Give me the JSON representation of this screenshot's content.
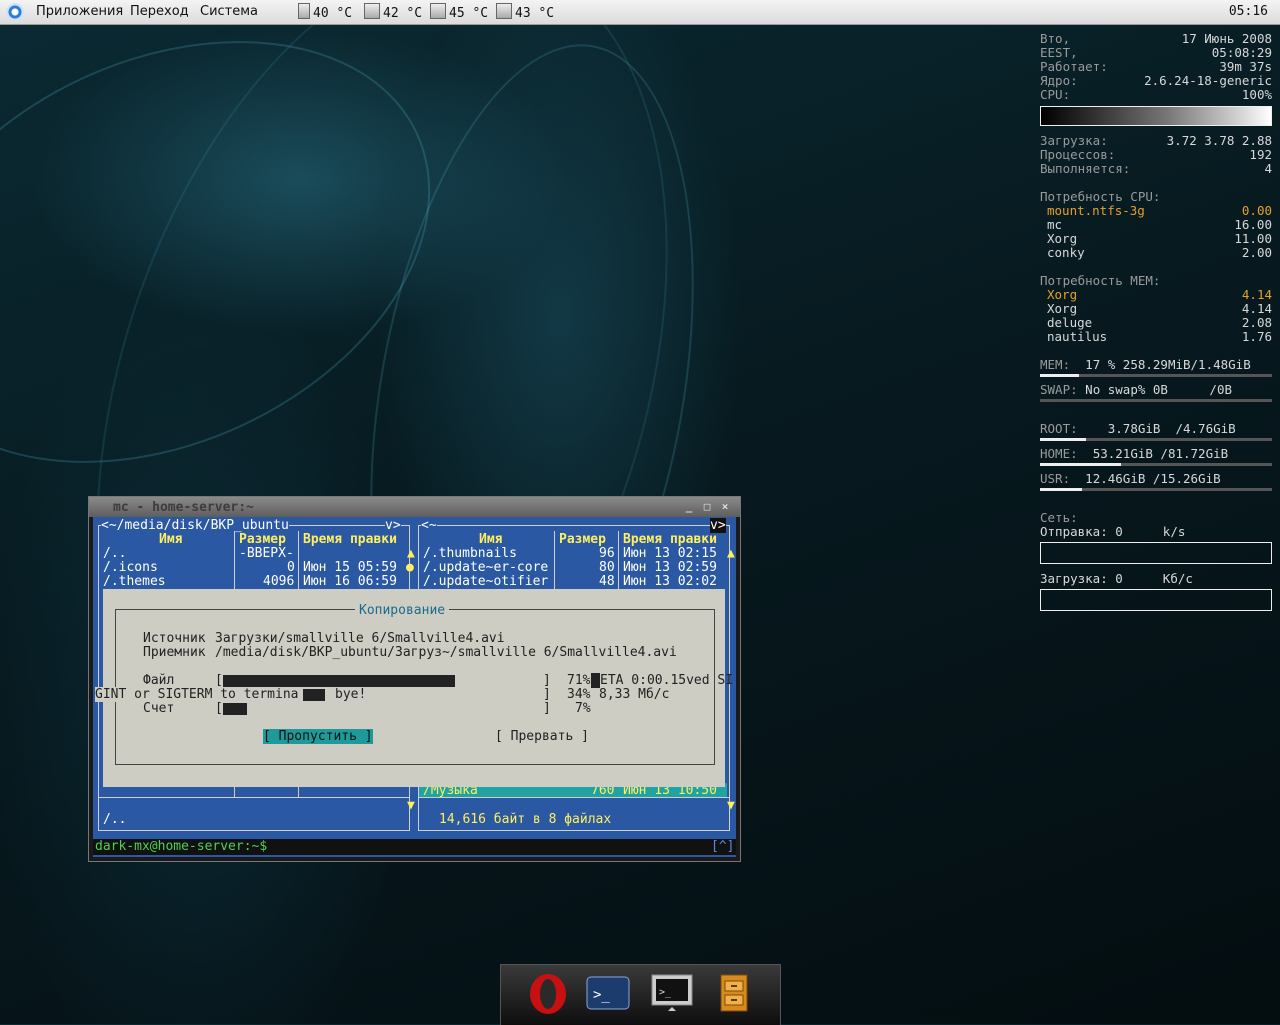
{
  "panel": {
    "menus": [
      "Приложения",
      "Переход",
      "Система"
    ],
    "temps": [
      "40 °C",
      "42 °C",
      "45 °C",
      "43 °C"
    ],
    "clock": "05:16"
  },
  "conky": {
    "date_label": "Вто,",
    "date_value": "17 Июнь 2008",
    "tz_label": "EEST,",
    "time_value": "05:08:29",
    "uptime_label": "Работает:",
    "uptime_value": "39m 37s",
    "kernel_label": "Ядро:",
    "kernel_value": "2.6.24-18-generic",
    "cpu_label": "CPU:",
    "cpu_value": "100%",
    "load_label": "Загрузка:",
    "load_value": "3.72 3.78 2.88",
    "procs_label": "Процессов:",
    "procs_value": "192",
    "running_label": "Выполняется:",
    "running_value": "4",
    "cpu_top_title": "Потребность CPU:",
    "cpu_top": [
      {
        "name": "mount.ntfs-3g",
        "value": "0.00"
      },
      {
        "name": "mc",
        "value": "16.00"
      },
      {
        "name": "Xorg",
        "value": "11.00"
      },
      {
        "name": "conky",
        "value": "2.00"
      }
    ],
    "mem_top_title": "Потребность MEM:",
    "mem_top": [
      {
        "name": "Xorg",
        "value": "4.14"
      },
      {
        "name": "Xorg",
        "value": "4.14"
      },
      {
        "name": "deluge",
        "value": "2.08"
      },
      {
        "name": "nautilus",
        "value": "1.76"
      }
    ],
    "mem_label": "MEM:",
    "mem_value": "17 % 258.29MiB/1.48GiB",
    "mem_fill": 0.17,
    "swap_label": "SWAP:",
    "swap_value": "No swap% 0B",
    "swap_total": "/0B",
    "root_label": "ROOT:",
    "root_value": "3.78GiB  /4.76GiB",
    "root_fill": 0.2,
    "home_label": "HOME:",
    "home_value": "53.21GiB /81.72GiB",
    "home_fill": 0.35,
    "usr_label": "USR:",
    "usr_value": "12.46GiB /15.26GiB",
    "usr_fill": 0.18,
    "net_label": "Сеть:",
    "up_label": "Отправка:",
    "up_value": "0",
    "up_unit": "k/s",
    "down_label": "Загрузка:",
    "down_value": "0",
    "down_unit": "Кб/с"
  },
  "mc": {
    "window_title": "mc - home-server:~",
    "left_path": "<~/media/disk/BKP_ubuntu",
    "left_path_btn": "v>",
    "right_path": "<~",
    "right_path_btn": "v>",
    "col_name": "Имя",
    "col_size": "Размер",
    "col_mtime": "Время правки",
    "left_rows": [
      {
        "name": "/..",
        "size": "-ВВЕРХ-",
        "mtime": ""
      },
      {
        "name": "/.icons",
        "size": "0",
        "mtime": "Июн 15 05:59"
      },
      {
        "name": "/.themes",
        "size": "4096",
        "mtime": "Июн 16 06:59"
      }
    ],
    "right_rows": [
      {
        "name": "/.thumbnails",
        "size": "96",
        "mtime": "Июн 13 02:15"
      },
      {
        "name": "/.update~er-core",
        "size": "80",
        "mtime": "Июн 13 02:59"
      },
      {
        "name": "/.update~otifier",
        "size": "48",
        "mtime": "Июн 13 02:02"
      }
    ],
    "right_selected": {
      "name": "/Музыка",
      "size": "760",
      "mtime": "Июн 13 10:50"
    },
    "left_mini": "/..",
    "right_mini": "14,616 байт в 8 файлах",
    "prompt": "dark-mx@home-server:~$",
    "prompt_btn": "[^]",
    "dialog": {
      "title": "Копирование",
      "source_label": "Источник",
      "source": "Загрузки/smallville 6/Smallville4.avi",
      "dest_label": "Приемник",
      "dest": "/media/disk/BKP_ubuntu/Загруз~/smallville 6/Smallville4.avi",
      "file_label": "Файл",
      "file_pct": "71%",
      "file_fill": 0.71,
      "eta_text": "ETA 0:00.15ved SI",
      "line2_left": "GINT or SIGTERM to termina",
      "line2_bye": "bye!",
      "line2_pct": "34%",
      "rate": "8,33 Мб/с",
      "count_label": "Счет",
      "count_pct": "7%",
      "count_fill": 0.07,
      "skip_button": "[ Пропустить ]",
      "abort_button": "[ Прервать ]"
    }
  },
  "dock": {
    "items": [
      "opera-icon",
      "terminal-icon",
      "monitor-terminal-icon",
      "file-cabinet-icon"
    ]
  }
}
